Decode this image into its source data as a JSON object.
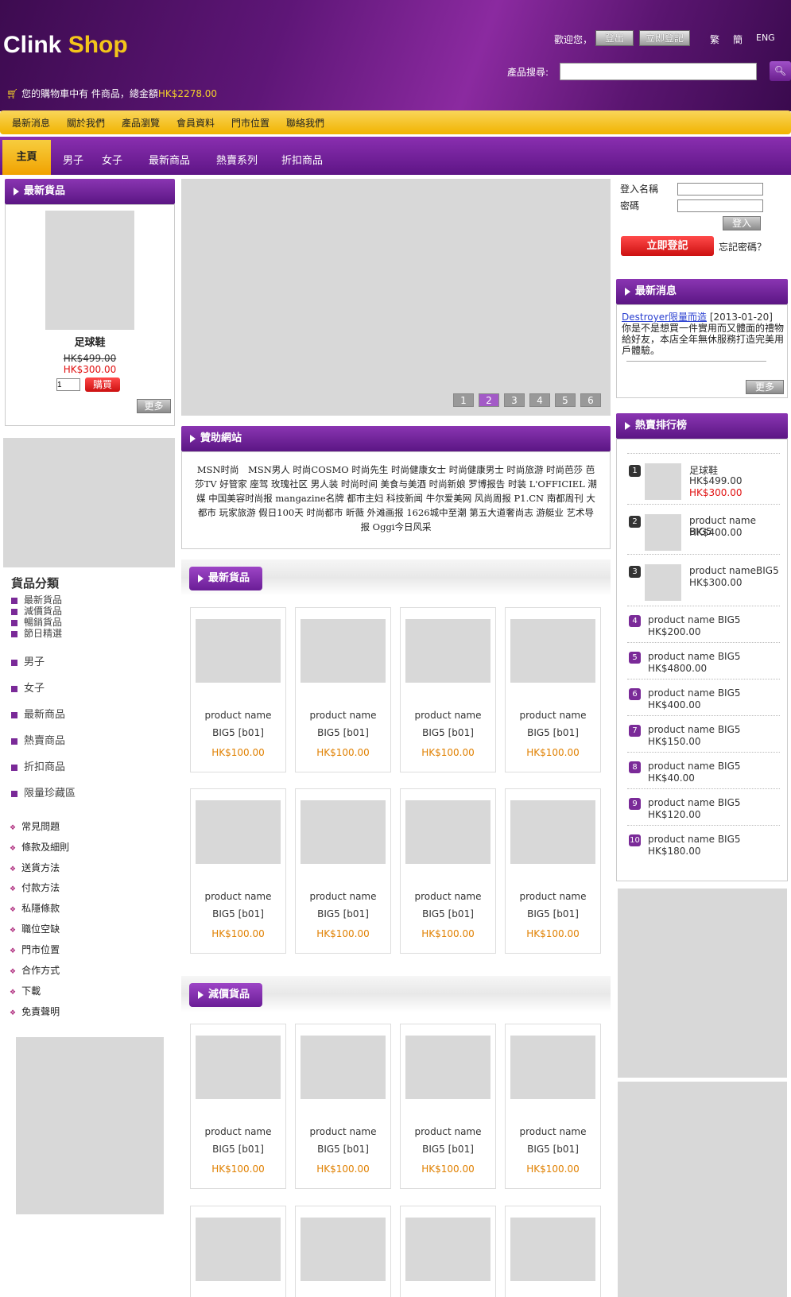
{
  "header": {
    "logo_part1": "Clink",
    "logo_part2": "Shop",
    "welcome": "歡迎您，",
    "logout": "登出",
    "register": "立即登記",
    "lang_trad": "繁",
    "lang_simp": "簡",
    "lang_eng": "ENG",
    "search_label": "產品搜尋:",
    "search_value": "",
    "cart_prefix": "您的購物車中有  件商品，總金額",
    "cart_amount": "HK$2278.00"
  },
  "top_nav": [
    "最新消息",
    "關於我們",
    "產品瀏覽",
    "會員資料",
    "門市位置",
    "聯絡我們"
  ],
  "main_nav": {
    "home": "主頁",
    "items": [
      "男子",
      "女子",
      "最新商品",
      "熱賣系列",
      "折扣商品"
    ]
  },
  "left": {
    "new_title": "最新貨品",
    "product_name": "足球鞋",
    "old_price": "HK$499.00",
    "new_price": "HK$300.00",
    "qty": "1",
    "buy": "購買",
    "more": "更多",
    "category_title": "貨品分類",
    "sub_cats": [
      "最新貨品",
      "減價貨品",
      "暢銷貨品",
      "節日精選"
    ],
    "cats": [
      "男子",
      "女子",
      "最新商品",
      "熱賣商品",
      "折扣商品",
      "限量珍藏區"
    ],
    "info_links": [
      "常見問題",
      "條款及細則",
      "送貨方法",
      "付款方法",
      "私隱條款",
      "職位空缺",
      "門市位置",
      "合作方式",
      "下載",
      "免責聲明"
    ]
  },
  "slider": {
    "dots": [
      "1",
      "2",
      "3",
      "4",
      "5",
      "6"
    ],
    "active": 2
  },
  "sponsor": {
    "title": "贊助網站",
    "text": "MSN时尚　MSN男人 时尚COSMO 时尚先生 时尚健康女士 时尚健康男士 时尚旅游 时尚芭莎 芭莎TV 好管家 座驾 玫瑰社区 男人装 时尚时间 美食与美酒 时尚新娘 罗博报告 时装 L'OFFICIEL 潮媒 中国美容时尚报 mangazine名牌 都市主妇 科技新闻 牛尔爱美网 风尚周报 P1.CN 南都周刊 大都市 玩家旅游 假日100天 时尚都市 昕薇 外滩画报 1626城中至潮 第五大道奢尚志 游艇业 艺术导报 Oggi今日风采"
  },
  "sections": [
    {
      "title": "最新貨品"
    },
    {
      "title": "減價貨品"
    }
  ],
  "product_card": {
    "name1": "product name",
    "name2": "BIG5 [b01]",
    "price": "HK$100.00"
  },
  "login": {
    "username_label": "登入名稱",
    "password_label": "密碼",
    "login_btn": "登入",
    "register_btn": "立即登記",
    "forgot": "忘記密碼？"
  },
  "news": {
    "title": "最新消息",
    "link": "Destroyer限量而造",
    "date": "[2013-01-20]",
    "body": "你是不是想買一件實用而又體面的禮物給好友，本店全年無休服務打造完美用戶體驗。",
    "more": "更多"
  },
  "ranking": {
    "title": "熱賣排行榜",
    "items": [
      {
        "rank": "1",
        "name": "足球鞋",
        "price": "HK$499.00",
        "sale": "HK$300.00"
      },
      {
        "rank": "2",
        "name": "product name BIG5",
        "price": "HK$400.00"
      },
      {
        "rank": "3",
        "name": "product nameBIG5",
        "price": "HK$300.00"
      },
      {
        "rank": "4",
        "name": "product name BIG5",
        "price": "HK$200.00"
      },
      {
        "rank": "5",
        "name": "product name BIG5",
        "price": "HK$4800.00"
      },
      {
        "rank": "6",
        "name": "product name BIG5",
        "price": "HK$400.00"
      },
      {
        "rank": "7",
        "name": "product name BIG5",
        "price": "HK$150.00"
      },
      {
        "rank": "8",
        "name": "product name BIG5",
        "price": "HK$40.00"
      },
      {
        "rank": "9",
        "name": "product name BIG5",
        "price": "HK$120.00"
      },
      {
        "rank": "10",
        "name": "product name BIG5",
        "price": "HK$180.00"
      }
    ]
  }
}
